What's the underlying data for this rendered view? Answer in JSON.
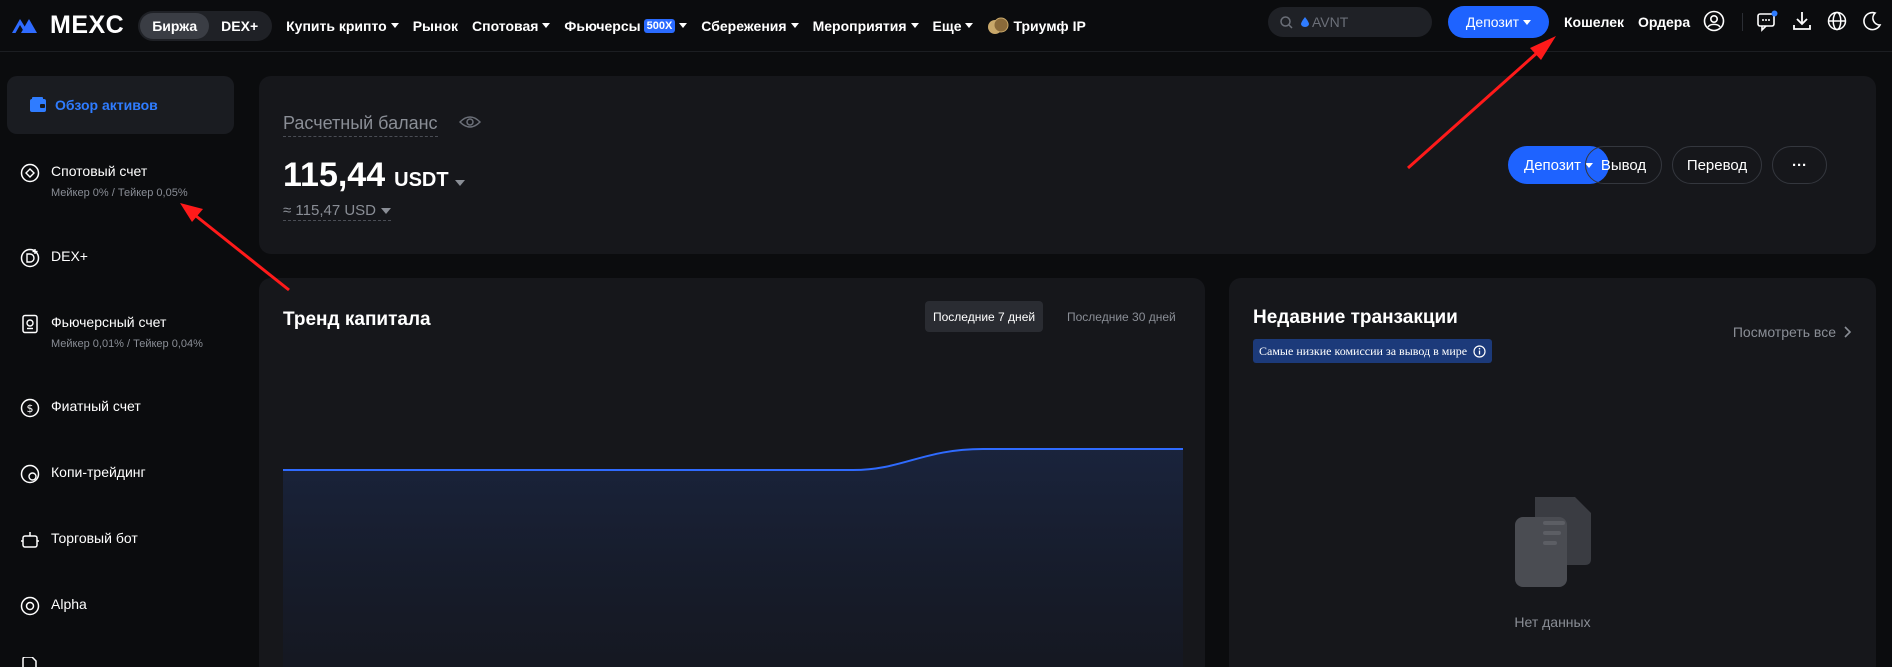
{
  "brand": {
    "name": "MEXC"
  },
  "header": {
    "segments": [
      "Биржа",
      "DEX+"
    ],
    "active_segment": "Биржа",
    "nav": [
      {
        "label": "Купить крипто",
        "dropdown": true
      },
      {
        "label": "Рынок",
        "dropdown": false
      },
      {
        "label": "Спотовая",
        "dropdown": true
      },
      {
        "label": "Фьючерсы",
        "dropdown": true,
        "badge": "500X"
      },
      {
        "label": "Сбережения",
        "dropdown": true
      },
      {
        "label": "Мероприятия",
        "dropdown": true
      },
      {
        "label": "Еще",
        "dropdown": true
      },
      {
        "label": "Триумф IP",
        "dropdown": false,
        "icon": "coins-icon"
      }
    ],
    "search_placeholder": "AVNT",
    "deposit_label": "Депозит",
    "wallet_label": "Кошелек",
    "orders_label": "Ордера",
    "icons": [
      "user-icon",
      "message-icon",
      "download-icon",
      "globe-icon",
      "moon-icon"
    ]
  },
  "sidebar": {
    "items": [
      {
        "label": "Обзор активов",
        "icon": "wallet-icon",
        "active": true
      },
      {
        "label": "Спотовый счет",
        "sub": "Мейкер 0% / Тейкер 0,05%",
        "icon": "spot-icon"
      },
      {
        "label": "DEX+",
        "icon": "dex-icon"
      },
      {
        "label": "Фьючерсный счет",
        "sub": "Мейкер 0,01% / Тейкер 0,04%",
        "icon": "futures-icon"
      },
      {
        "label": "Фиатный счет",
        "icon": "dollar-icon"
      },
      {
        "label": "Копи-трейдинг",
        "icon": "copy-trading-icon"
      },
      {
        "label": "Торговый бот",
        "icon": "bot-icon"
      },
      {
        "label": "Alpha",
        "icon": "alpha-icon"
      }
    ]
  },
  "balance": {
    "title": "Расчетный баланс",
    "amount": "115,44",
    "currency": "USDT",
    "approx": "≈ 115,47 USD",
    "buttons": {
      "deposit": "Депозит",
      "withdraw": "Вывод",
      "transfer": "Перевод",
      "more": "···"
    }
  },
  "trend": {
    "title": "Тренд капитала",
    "periods": [
      "Последние 7 дней",
      "Последние 30 дней"
    ],
    "active_period": "Последние 7 дней",
    "line_color": "#2f6bff"
  },
  "transactions": {
    "title": "Недавние транзакции",
    "badge": "Самые низкие комиссии за вывод в мире",
    "view_all": "Посмотреть все",
    "empty": "Нет данных"
  },
  "colors": {
    "accent": "#1e63ff",
    "active_text": "#2f7cff",
    "annotation_arrow": "#ff1a1a"
  }
}
